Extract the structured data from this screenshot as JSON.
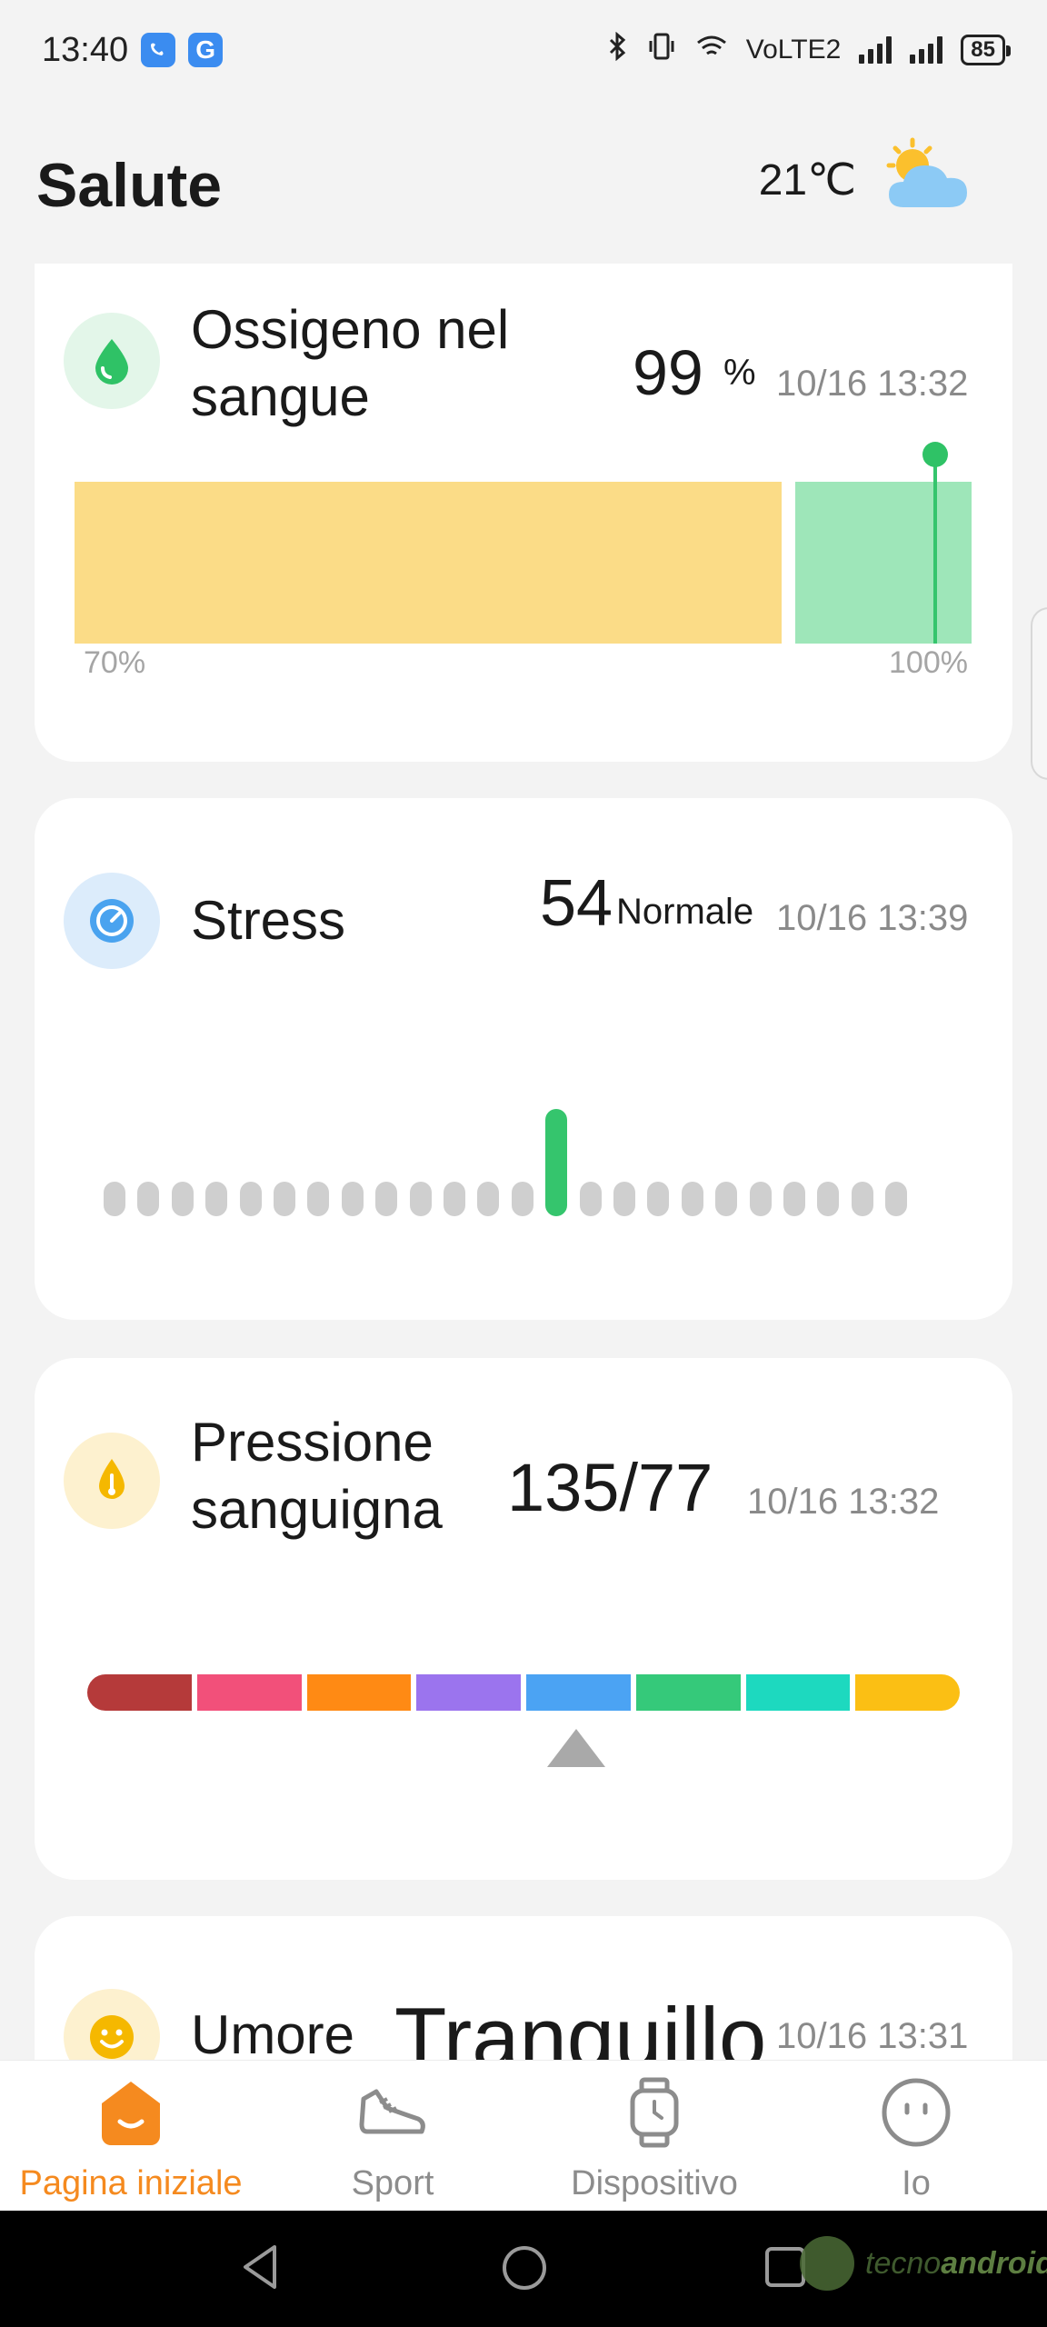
{
  "status_bar": {
    "time": "13:40",
    "app_letter": "G",
    "network": "VoLTE2",
    "battery": "85"
  },
  "header": {
    "title": "Salute",
    "temperature": "21℃",
    "weather_icon": "partly-cloudy-icon"
  },
  "cards": {
    "blood_oxygen": {
      "label": "Ossigeno nel\nsangue",
      "value": "99",
      "unit": "%",
      "timestamp": "10/16 13:32",
      "axis_min": "70%",
      "axis_max": "100%",
      "icon": "water-drop-icon",
      "icon_bg": "#e3f6e9",
      "icon_color": "#2fc266"
    },
    "stress": {
      "label": "Stress",
      "value": "54",
      "state": "Normale",
      "timestamp": "10/16 13:39",
      "bar_count": 24,
      "highlight_index": 13,
      "icon": "gauge-icon",
      "icon_bg": "#dcecfb",
      "icon_color": "#4aa3ef",
      "bar_color": "#cfcfcf",
      "highlight_color": "#35c56d"
    },
    "blood_pressure": {
      "label": "Pressione\nsanguigna",
      "value": "135/77",
      "timestamp": "10/16 13:32",
      "scale_colors": [
        "#b53a3a",
        "#f2507a",
        "#ff8a14",
        "#9b74ee",
        "#4ba3f3",
        "#35c97a",
        "#1dd9bf",
        "#fbbf14"
      ],
      "pointer_segment": 4,
      "icon": "blood-pressure-icon",
      "icon_bg": "#fdf1cf",
      "icon_color": "#f5b800"
    },
    "mood": {
      "label": "Umore",
      "value": "Tranquillo",
      "timestamp": "10/16 13:31",
      "icon": "smiley-icon",
      "icon_bg": "#fdf1cf",
      "icon_color": "#f5b800"
    }
  },
  "bottom_nav": [
    {
      "label": "Pagina iniziale",
      "icon": "home-icon",
      "active": true
    },
    {
      "label": "Sport",
      "icon": "sneaker-icon",
      "active": false
    },
    {
      "label": "Dispositivo",
      "icon": "watch-icon",
      "active": false
    },
    {
      "label": "Io",
      "icon": "face-icon",
      "active": false
    }
  ],
  "watermark": {
    "prefix": "tecno",
    "suffix": "android"
  },
  "colors": {
    "accent": "#f58a1f",
    "card_bg": "#ffffff",
    "page_bg": "#f3f3f3"
  }
}
